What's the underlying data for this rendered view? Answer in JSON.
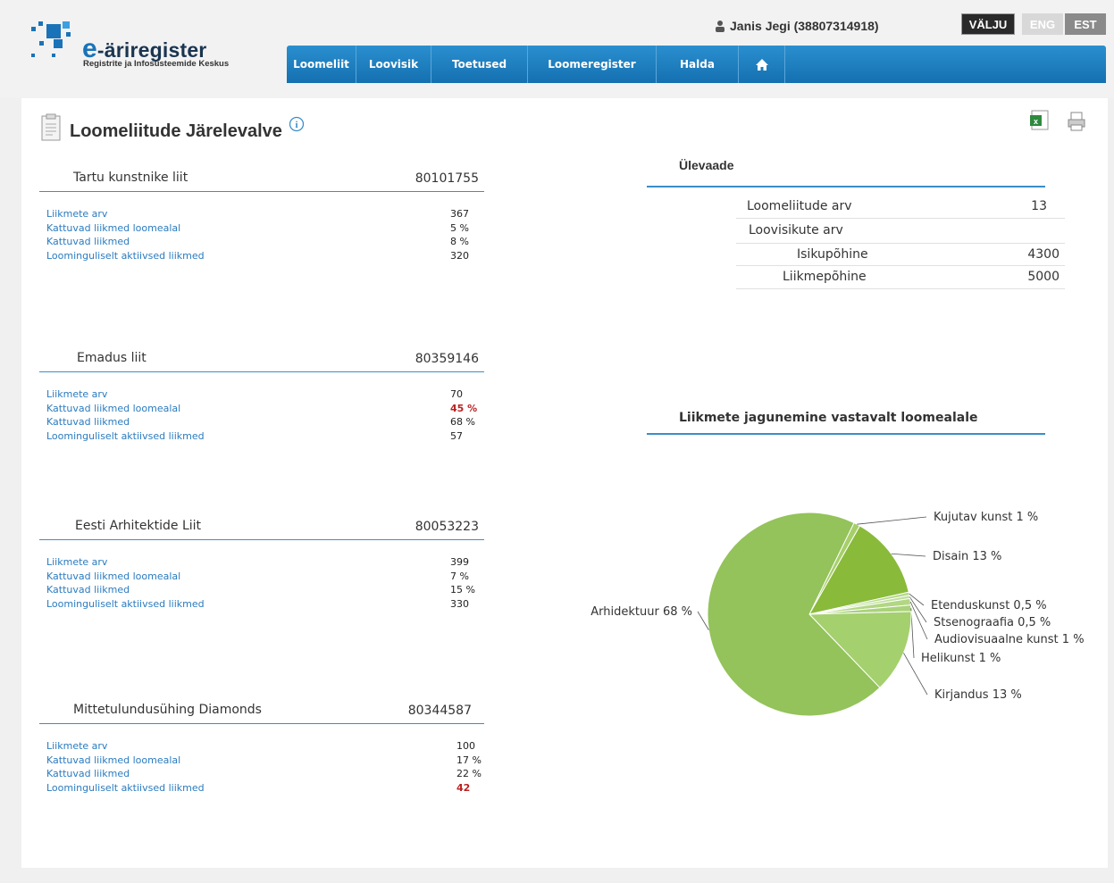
{
  "header": {
    "logo_title_rest": "-äriregister",
    "logo_title_e": "e",
    "logo_subtitle": "Registrite ja Infosüsteemide Keskus",
    "user": "Janis Jegi (38807314918)",
    "logout_label": "VÄLJU",
    "lang_eng": "ENG",
    "lang_est": "EST"
  },
  "nav": {
    "items": [
      "Loomeliit",
      "Loovisik",
      "Toetused",
      "Loomeregister",
      "Halda"
    ]
  },
  "page": {
    "title": "Loomeliitude Järelevalve"
  },
  "organizations": [
    {
      "name": "Tartu kunstnike liit",
      "code": "80101755",
      "stats": [
        {
          "label": "Liikmete arv",
          "value": "367",
          "red": false
        },
        {
          "label": "Kattuvad liikmed loomealal",
          "value": "5 %",
          "red": false
        },
        {
          "label": "Kattuvad liikmed",
          "value": "8 %",
          "red": false
        },
        {
          "label": "Loominguliselt aktiivsed liikmed",
          "value": "320",
          "red": false
        }
      ]
    },
    {
      "name": "Emadus liit",
      "code": "80359146",
      "stats": [
        {
          "label": "Liikmete arv",
          "value": "70",
          "red": false
        },
        {
          "label": "Kattuvad liikmed loomealal",
          "value": "45 %",
          "red": true
        },
        {
          "label": "Kattuvad liikmed",
          "value": "68 %",
          "red": false
        },
        {
          "label": "Loominguliselt aktiivsed liikmed",
          "value": "57",
          "red": false
        }
      ]
    },
    {
      "name": "Eesti Arhitektide Liit",
      "code": "80053223",
      "stats": [
        {
          "label": "Liikmete arv",
          "value": "399",
          "red": false
        },
        {
          "label": "Kattuvad liikmed loomealal",
          "value": "7 %",
          "red": false
        },
        {
          "label": "Kattuvad liikmed",
          "value": "15 %",
          "red": false
        },
        {
          "label": "Loominguliselt aktiivsed liikmed",
          "value": "330",
          "red": false
        }
      ]
    },
    {
      "name": "Mittetulundusühing Diamonds",
      "code": "80344587",
      "stats": [
        {
          "label": "Liikmete arv",
          "value": "100",
          "red": false
        },
        {
          "label": "Kattuvad liikmed loomealal",
          "value": "17 %",
          "red": false
        },
        {
          "label": "Kattuvad liikmed",
          "value": "22 %",
          "red": false
        },
        {
          "label": "Loominguliselt aktiivsed liikmed",
          "value": "42",
          "red": true
        }
      ]
    }
  ],
  "overview": {
    "title": "Ülevaade",
    "rows": [
      {
        "label": "Loomeliitude arv",
        "value": "13"
      },
      {
        "label": "Loovisikute arv",
        "value": ""
      },
      {
        "label": "Isikupõhine",
        "value": "4300"
      },
      {
        "label": "Liikmepõhine",
        "value": "5000"
      }
    ]
  },
  "chart_data": {
    "type": "pie",
    "title": "Liikmete jagunemine vastavalt loomealale",
    "slices": [
      {
        "name": "Kujutav kunst",
        "label": "Kujutav kunst  1 %",
        "value": 1,
        "color": "#a6cf6a"
      },
      {
        "name": "Disain",
        "label": "Disain  13 %",
        "value": 13,
        "color": "#8aba3a"
      },
      {
        "name": "Etenduskunst",
        "label": "Etenduskunst  0,5 %",
        "value": 0.5,
        "color": "#b6d98a"
      },
      {
        "name": "Stsenograafia",
        "label": "Stsenograafia  0,5 %",
        "value": 0.5,
        "color": "#bfe09a"
      },
      {
        "name": "Audiovisuaalne kunst",
        "label": "Audiovisuaalne kunst 1 %",
        "value": 1,
        "color": "#b2d784"
      },
      {
        "name": "Helikunst",
        "label": "Helikunst  1 %",
        "value": 1,
        "color": "#a9d27a"
      },
      {
        "name": "Kirjandus",
        "label": "Kirjandus 13 %",
        "value": 13,
        "color": "#a5d06e"
      },
      {
        "name": "Arhidektuur",
        "label": "Arhidektuur 68 %",
        "value": 68,
        "color": "#93c35a"
      }
    ]
  }
}
